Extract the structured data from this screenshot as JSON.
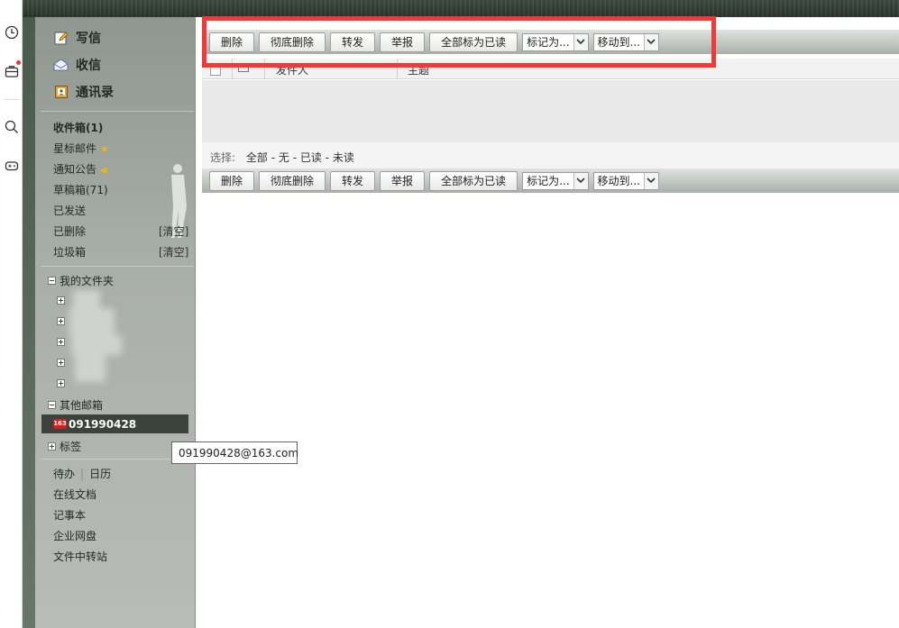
{
  "sidebar": {
    "compose": "写信",
    "inbox_main": "收信",
    "contacts": "通讯录",
    "folders": {
      "inbox": "收件箱(1)",
      "starred": "星标邮件",
      "notice": "通知公告",
      "drafts": "草稿箱(71)",
      "sent": "已发送",
      "deleted": "已删除",
      "junk": "垃圾箱",
      "clear": "[清空]"
    },
    "my_folders": "我的文件夹",
    "other_mailboxes": "其他邮箱",
    "account": "091990428",
    "tags": "标签",
    "tooltip": "091990428@163.com",
    "utilities": {
      "todo": "待办",
      "calendar": "日历",
      "docs": "在线文档",
      "notebook": "记事本",
      "drive": "企业网盘",
      "transfer": "文件中转站"
    }
  },
  "toolbar": {
    "delete": "删除",
    "delete_permanent": "彻底删除",
    "forward": "转发",
    "report": "举报",
    "mark_all_read": "全部标为已读",
    "mark_as": "标记为...",
    "move_to": "移动到..."
  },
  "list": {
    "col_sender": "发件人",
    "col_subject": "主题"
  },
  "select_bar": {
    "label": "选择:",
    "all": "全部",
    "none": "无",
    "read": "已读",
    "unread": "未读",
    "sep": " - "
  },
  "logo_163": "163"
}
